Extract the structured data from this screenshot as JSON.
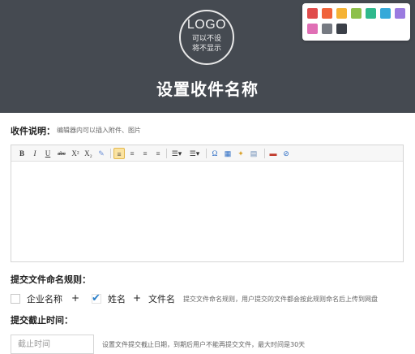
{
  "header": {
    "logo_main": "LOGO",
    "logo_sub_line1": "可以不设",
    "logo_sub_line2": "将不显示",
    "title": "设置收件名称",
    "background": "#454a51"
  },
  "palette": {
    "colors": [
      "#e04b4b",
      "#f0623a",
      "#f5b335",
      "#8dc04a",
      "#2fb98d",
      "#35a9d9",
      "#9a7be0",
      "#e06fb5",
      "#767a82",
      "#3b4048"
    ]
  },
  "description": {
    "label": "收件说明：",
    "hint": "编辑器内可以插入附件、图片"
  },
  "toolbar": {
    "items": [
      {
        "icon": "bold-icon",
        "glyph": "B"
      },
      {
        "icon": "italic-icon",
        "glyph": "I"
      },
      {
        "icon": "underline-icon",
        "glyph": "U"
      },
      {
        "icon": "strikethrough-icon",
        "glyph": "abc"
      },
      {
        "icon": "superscript-icon",
        "glyph": "X²"
      },
      {
        "icon": "subscript-icon",
        "glyph": "X₂"
      },
      {
        "icon": "eraser-icon",
        "glyph": "✎"
      },
      {
        "icon": "align-left-icon",
        "glyph": "≡"
      },
      {
        "icon": "align-center-icon",
        "glyph": "≡"
      },
      {
        "icon": "align-right-icon",
        "glyph": "≡"
      },
      {
        "icon": "align-justify-icon",
        "glyph": "≡"
      },
      {
        "icon": "ordered-list-icon",
        "glyph": "☰▾"
      },
      {
        "icon": "unordered-list-icon",
        "glyph": "☰▾"
      },
      {
        "icon": "omega-icon",
        "glyph": "Ω"
      },
      {
        "icon": "table-icon",
        "glyph": "▦"
      },
      {
        "icon": "magic-icon",
        "glyph": "✦"
      },
      {
        "icon": "preview-icon",
        "glyph": "▤"
      },
      {
        "icon": "image-icon",
        "glyph": "▬"
      },
      {
        "icon": "attachment-icon",
        "glyph": "⊘"
      }
    ]
  },
  "naming": {
    "label": "提交文件命名规则：",
    "opt1": "企业名称",
    "opt1_checked": false,
    "plus1": "+",
    "opt2": "姓名",
    "opt2_checked": true,
    "plus2": "+",
    "opt3": "文件名",
    "hint": "提交文件命名规则，用户提交的文件都会按此规则命名后上传到网盘"
  },
  "deadline": {
    "label": "提交截止时间：",
    "placeholder": "截止时间",
    "hint": "设置文件提交截止日期，到期后用户不能再提交文件，最大时间是30天"
  }
}
